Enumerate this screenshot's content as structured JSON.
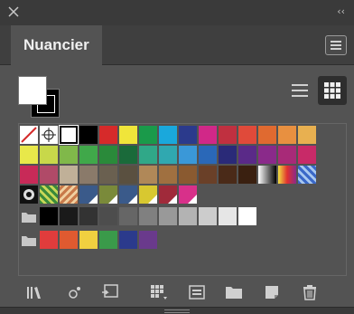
{
  "panel": {
    "title": "Nuancier"
  },
  "colors": {
    "chrome": "#3a3a3a",
    "panel_bg": "#535353",
    "accent_active_view": "#2e2e2e"
  },
  "views": {
    "active": "grid"
  },
  "swatches": {
    "row1": [
      "#ffffff",
      "#000000",
      "#d62a2a",
      "#f0e53a",
      "#1a9a4a",
      "#1aa8dc",
      "#2b3a8c",
      "#d12888",
      "#e03c3c",
      "#e05a30",
      "#e08a30",
      "#e8a040",
      "#e8b050"
    ],
    "row2": [
      "#e8e84a",
      "#c8d84a",
      "#80b84a",
      "#40a84a",
      "#40a860",
      "#30a888",
      "#30a8b0",
      "#3a88c8",
      "#3a58a8",
      "#3a3a88",
      "#5a2a88",
      "#a02a88",
      "#c82a68"
    ],
    "row3": [
      "#c82a58",
      "#b08a78",
      "#a08a6a",
      "#887868",
      "#6a6050",
      "#5a5040",
      "#b08858",
      "#a07040",
      "#8a5a30",
      "#6a4028",
      "#4a2a18"
    ],
    "row4_spot": [
      "#7a8a3a",
      "#3a5a8a",
      "#d8c830",
      "#a02a3a",
      "#d8308a"
    ],
    "row5_grays": [
      "#000000",
      "#1a1a1a",
      "#333333",
      "#4d4d4d",
      "#666666",
      "#808080",
      "#999999",
      "#b3b3b3",
      "#cccccc",
      "#e6e6e6",
      "#ffffff"
    ],
    "row6_group": [
      "#e03c3c",
      "#e05a30",
      "#f0d040",
      "#3a9a4a",
      "#2b3a8c",
      "#6a3a8c"
    ]
  },
  "icons": {
    "close": "close-icon",
    "collapse": "collapse-icon",
    "menu": "panel-menu-icon",
    "list_view": "list-view-icon",
    "grid_view": "grid-view-icon",
    "libraries": "libraries-icon",
    "kind": "swatch-kind-icon",
    "place": "place-swatch-icon",
    "options": "swatch-options-icon",
    "delete": "trash-icon"
  }
}
